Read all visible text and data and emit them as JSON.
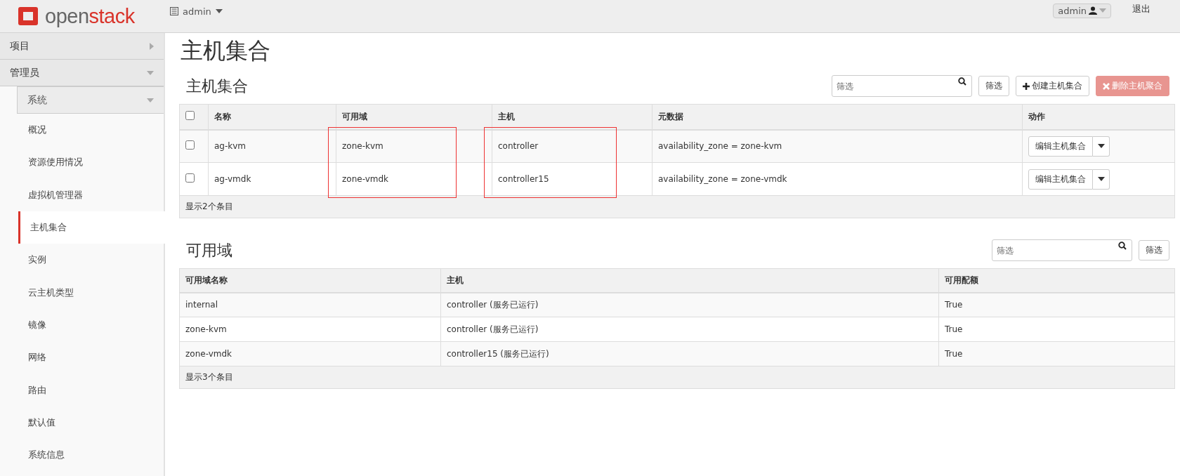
{
  "header": {
    "logo": {
      "part_1": "open",
      "part_2": "stack"
    },
    "project_menu": "admin",
    "user_menu": "admin",
    "logout": "退出"
  },
  "sidebar": {
    "items": [
      {
        "label": "项目",
        "expanded": false
      },
      {
        "label": "管理员",
        "expanded": true,
        "children": [
          {
            "label": "系统",
            "expanded": true,
            "children": [
              {
                "label": "概况",
                "selected": false
              },
              {
                "label": "资源使用情况",
                "selected": false
              },
              {
                "label": "虚拟机管理器",
                "selected": false
              },
              {
                "label": "主机集合",
                "selected": true
              },
              {
                "label": "实例",
                "selected": false
              },
              {
                "label": "云主机类型",
                "selected": false
              },
              {
                "label": "镜像",
                "selected": false
              },
              {
                "label": "网络",
                "selected": false
              },
              {
                "label": "路由",
                "selected": false
              },
              {
                "label": "默认值",
                "selected": false
              },
              {
                "label": "系统信息",
                "selected": false
              }
            ]
          }
        ]
      }
    ]
  },
  "page_title": "主机集合",
  "aggregates": {
    "title": "主机集合",
    "filter": {
      "placeholder": "筛选"
    },
    "filter_button": "筛选",
    "create_button": "创建主机集合",
    "delete_button": {
      "label": "删除主机聚合",
      "disabled": true
    },
    "select_all": {
      "checked": false
    },
    "columns": [
      {
        "label": "名称",
        "annotated": false
      },
      {
        "label": "可用域",
        "annotated": true
      },
      {
        "label": "主机",
        "annotated": true
      },
      {
        "label": "元数据",
        "annotated": false
      },
      {
        "label": "动作"
      }
    ],
    "rows": [
      {
        "checked": false,
        "cells": [
          "ag-kvm",
          "zone-kvm",
          "controller",
          "availability_zone = zone-kvm"
        ],
        "action": "编辑主机集合"
      },
      {
        "checked": false,
        "cells": [
          "ag-vmdk",
          "zone-vmdk",
          "controller15",
          "availability_zone = zone-vmdk"
        ],
        "action": "编辑主机集合"
      }
    ],
    "footer": "显示2个条目"
  },
  "zones": {
    "title": "可用域",
    "filter": {
      "placeholder": "筛选"
    },
    "filter_button": "筛选",
    "columns": [
      "可用域名称",
      "主机",
      "可用配额"
    ],
    "rows": [
      [
        "internal",
        "controller (服务已运行)",
        "True"
      ],
      [
        "zone-kvm",
        "controller (服务已运行)",
        "True"
      ],
      [
        "zone-vmdk",
        "controller15 (服务已运行)",
        "True"
      ]
    ],
    "footer": "显示3个条目"
  }
}
